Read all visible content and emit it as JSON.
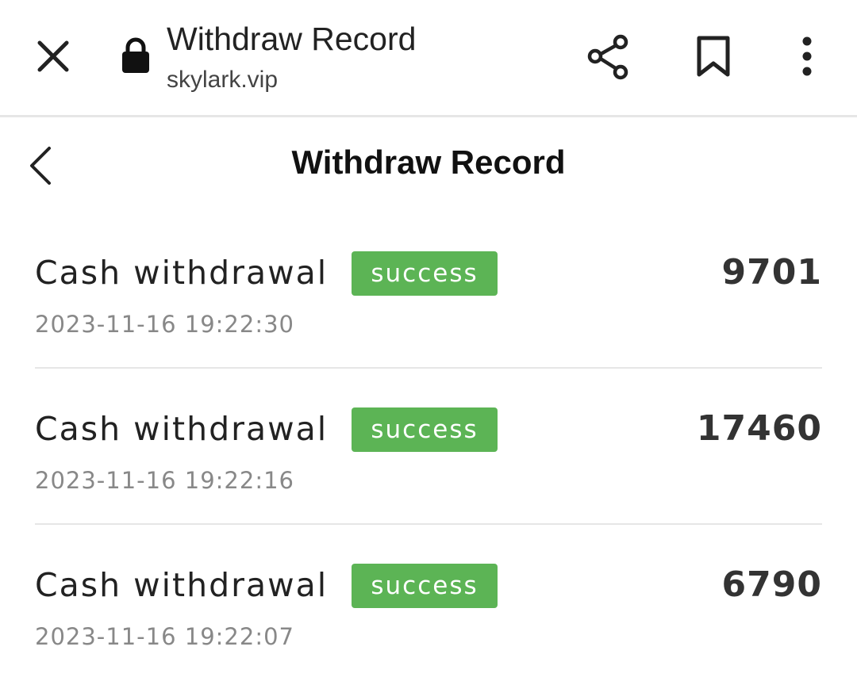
{
  "browser": {
    "title": "Withdraw Record",
    "domain": "skylark.vip",
    "icons": {
      "close": "close-icon",
      "lock": "lock-icon",
      "share": "share-icon",
      "bookmark": "bookmark-icon",
      "more": "more-vertical-icon"
    }
  },
  "header": {
    "title": "Withdraw Record",
    "back_icon": "chevron-left-icon"
  },
  "colors": {
    "status_success": "#5cb455",
    "divider": "#e6e6e6",
    "muted_text": "#888888"
  },
  "records": [
    {
      "type": "Cash withdrawal",
      "status": "success",
      "amount": "9701",
      "time": "2023-11-16 19:22:30"
    },
    {
      "type": "Cash withdrawal",
      "status": "success",
      "amount": "17460",
      "time": "2023-11-16 19:22:16"
    },
    {
      "type": "Cash withdrawal",
      "status": "success",
      "amount": "6790",
      "time": "2023-11-16 19:22:07"
    }
  ]
}
